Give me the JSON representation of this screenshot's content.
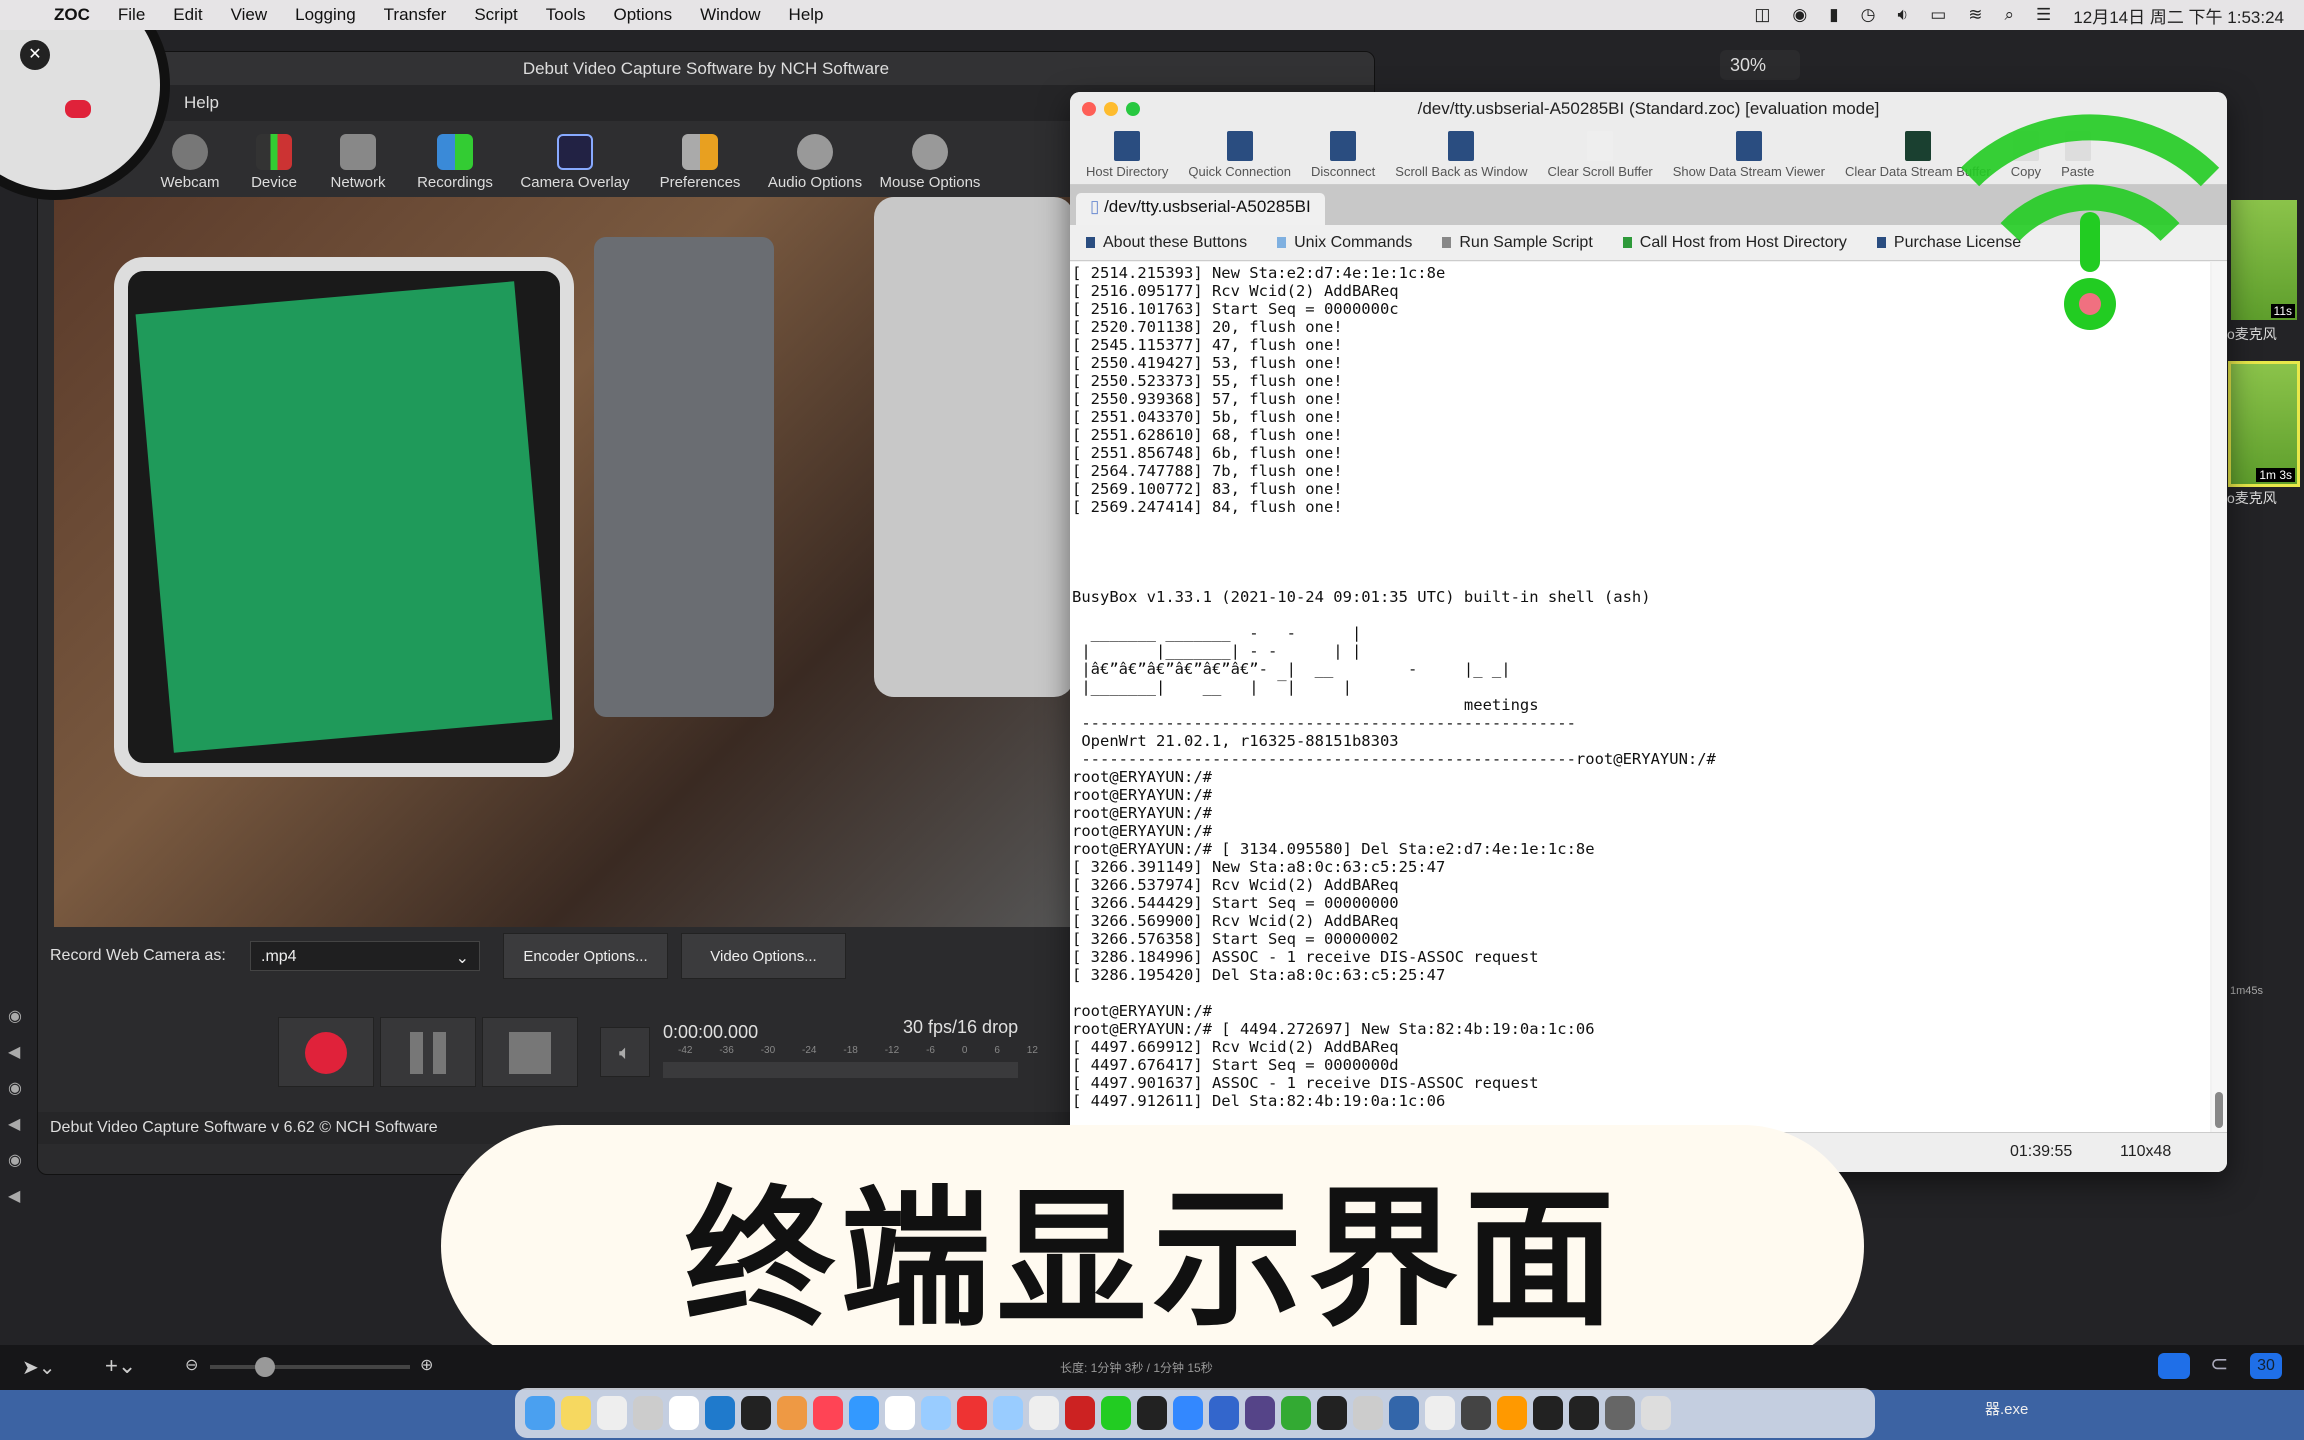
{
  "menubar": {
    "app": "ZOC",
    "items": [
      "File",
      "Edit",
      "View",
      "Logging",
      "Transfer",
      "Script",
      "Tools",
      "Options",
      "Window",
      "Help"
    ],
    "clock": "12月14日 周二 下午 1:53:24"
  },
  "editor": {
    "zoom": "30%",
    "timeline_length": "长度: 1分钟 3秒 / 1分钟 15秒",
    "thumbs": [
      {
        "duration": "11s",
        "label": "o麦克风"
      },
      {
        "duration": "1m 3s",
        "label": "o麦克风"
      }
    ],
    "bottom_badge": "30",
    "timecode_right": "1m45s"
  },
  "debut": {
    "title": "Debut Video Capture Software by NCH Software",
    "menu_help": "Help",
    "toolbar": [
      "Webcam",
      "Device",
      "Network",
      "Recordings",
      "Camera Overlay",
      "Preferences",
      "Audio Options",
      "Mouse Options"
    ],
    "record_as_label": "Record Web Camera as:",
    "format": ".mp4",
    "encoder_btn": "Encoder Options...",
    "video_btn": "Video Options...",
    "time": "0:00:00.000",
    "fps": "30 fps/16 drop",
    "meter_ticks": [
      "-42",
      "-36",
      "-30",
      "-24",
      "-18",
      "-12",
      "-6",
      "0",
      "6",
      "12"
    ],
    "status": "Debut Video Capture Software v 6.62 © NCH Software"
  },
  "zoc": {
    "title": "/dev/tty.usbserial-A50285BI (Standard.zoc) [evaluation mode]",
    "toolbar": [
      "Host Directory",
      "Quick Connection",
      "Disconnect",
      "Scroll Back as Window",
      "Clear Scroll Buffer",
      "Show Data Stream Viewer",
      "Clear Data Stream Buffer",
      "Copy",
      "Paste"
    ],
    "tab": "/dev/tty.usbserial-A50285BI",
    "buttons": [
      {
        "label": "About these Buttons",
        "color": "#2a4d80"
      },
      {
        "label": "Unix Commands",
        "color": "#7fb0e0"
      },
      {
        "label": "Run Sample Script",
        "color": "#888888"
      },
      {
        "label": "Call Host from Host Directory",
        "color": "#2e9a3a"
      },
      {
        "label": "Purchase License",
        "color": "#2a4d80"
      }
    ],
    "terminal": "[ 2514.215393] New Sta:e2:d7:4e:1e:1c:8e\n[ 2516.095177] Rcv Wcid(2) AddBAReq\n[ 2516.101763] Start Seq = 0000000c\n[ 2520.701138] 20, flush one!\n[ 2545.115377] 47, flush one!\n[ 2550.419427] 53, flush one!\n[ 2550.523373] 55, flush one!\n[ 2550.939368] 57, flush one!\n[ 2551.043370] 5b, flush one!\n[ 2551.628610] 68, flush one!\n[ 2551.856748] 6b, flush one!\n[ 2564.747788] 7b, flush one!\n[ 2569.100772] 83, flush one!\n[ 2569.247414] 84, flush one!\n\n\n\n\nBusyBox v1.33.1 (2021-10-24 09:01:35 UTC) built-in shell (ash)\n\n  _______ _______  -   -      |\n |       |_______| - -      | |\n |â€”â€”â€”â€”â€”â€”-  |  __        -     |_ _|\n |_______|    __   |  ‾|     |\n                                          meetings\n -----------------------------------------------------\n OpenWrt 21.02.1, r16325-88151b8303\n -----------------------------------------------------root@ERYAYUN:/#\nroot@ERYAYUN:/#\nroot@ERYAYUN:/#\nroot@ERYAYUN:/#\nroot@ERYAYUN:/#\nroot@ERYAYUN:/# [ 3134.095580] Del Sta:e2:d7:4e:1e:1c:8e\n[ 3266.391149] New Sta:a8:0c:63:c5:25:47\n[ 3266.537974] Rcv Wcid(2) AddBAReq\n[ 3266.544429] Start Seq = 00000000\n[ 3266.569900] Rcv Wcid(2) AddBAReq\n[ 3266.576358] Start Seq = 00000002\n[ 3286.184996] ASSOC - 1 receive DIS-ASSOC request\n[ 3286.195420] Del Sta:a8:0c:63:c5:25:47\n\nroot@ERYAYUN:/#\nroot@ERYAYUN:/# [ 4494.272697] New Sta:82:4b:19:0a:1c:06\n[ 4497.669912] Rcv Wcid(2) AddBAReq\n[ 4497.676417] Start Seq = 0000000d\n[ 4497.901637] ASSOC - 1 receive DIS-ASSOC request\n[ 4497.912611] Del Sta:82:4b:19:0a:1c:06\n\nroot@ERYAYUN:/#",
    "status_time": "01:39:55",
    "status_size": "110x48"
  },
  "caption": "终端显示界面",
  "dock_label": "器.exe",
  "colors": {
    "accent_green": "#22cc22",
    "record_red": "#e0223a",
    "badge_blue": "#1f6fe8"
  }
}
